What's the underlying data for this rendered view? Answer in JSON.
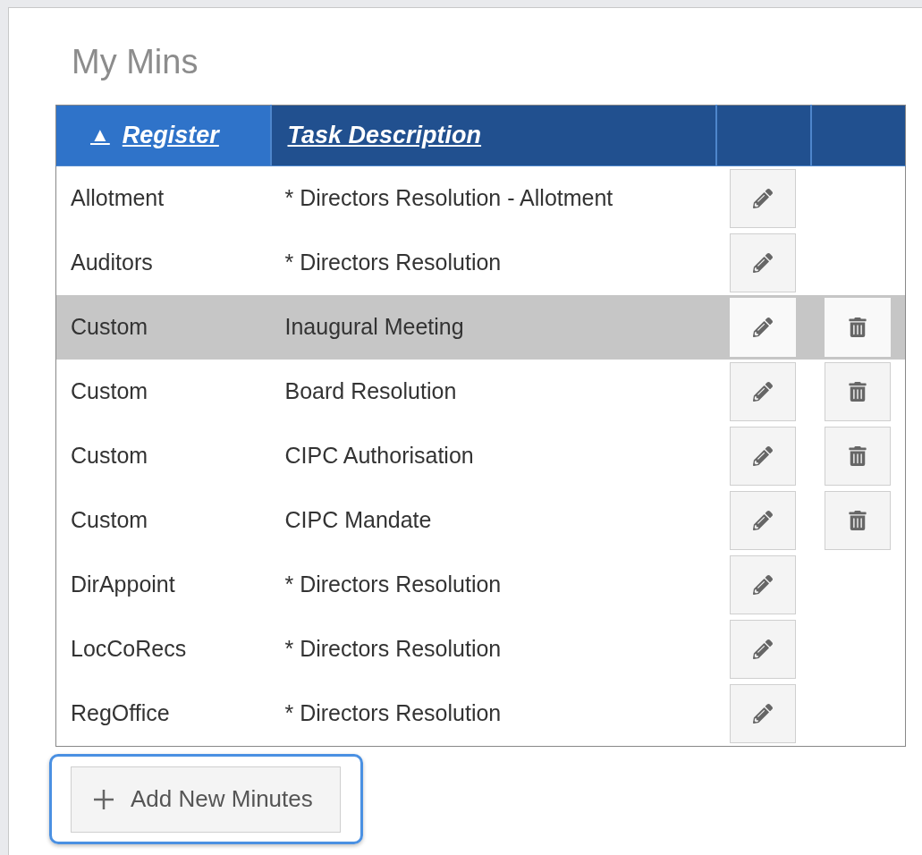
{
  "title": "My Mins",
  "table": {
    "columns": [
      {
        "label": "Register",
        "sort_indicator": "▲",
        "sorted": true
      },
      {
        "label": "Task Description",
        "sorted": false
      },
      {
        "sorted": false
      },
      {
        "sorted": false
      }
    ],
    "rows": [
      {
        "register": "Allotment",
        "task": "* Directors Resolution - Allotment",
        "highlighted": false,
        "deletable": false
      },
      {
        "register": "Auditors",
        "task": "* Directors Resolution",
        "highlighted": false,
        "deletable": false
      },
      {
        "register": "Custom",
        "task": "Inaugural Meeting",
        "highlighted": true,
        "deletable": true
      },
      {
        "register": "Custom",
        "task": "Board Resolution",
        "highlighted": false,
        "deletable": true
      },
      {
        "register": "Custom",
        "task": "CIPC Authorisation",
        "highlighted": false,
        "deletable": true
      },
      {
        "register": "Custom",
        "task": "CIPC Mandate",
        "highlighted": false,
        "deletable": true
      },
      {
        "register": "DirAppoint",
        "task": "* Directors Resolution",
        "highlighted": false,
        "deletable": false
      },
      {
        "register": "LocCoRecs",
        "task": "* Directors Resolution",
        "highlighted": false,
        "deletable": false
      },
      {
        "register": "RegOffice",
        "task": "* Directors Resolution",
        "highlighted": false,
        "deletable": false
      }
    ]
  },
  "add_button": {
    "label": "Add New Minutes",
    "focused": true
  }
}
